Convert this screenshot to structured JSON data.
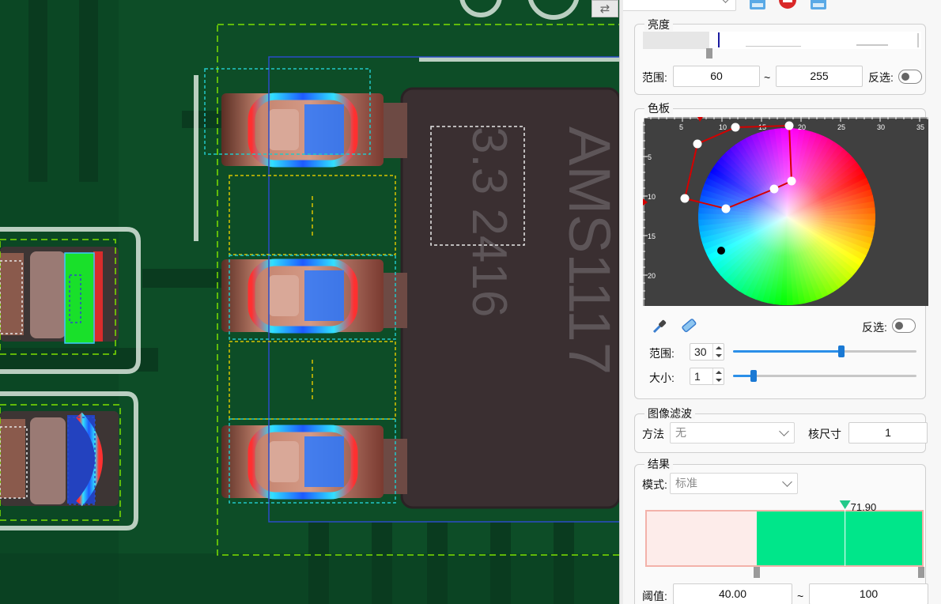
{
  "viewer": {
    "chip_top_text": "AMS1117",
    "chip_bottom_text": "3.3 2416",
    "swap_icon": "swap-arrows-icon"
  },
  "toolbar": {
    "icons": [
      "save-icon",
      "stop-icon",
      "save-as-icon"
    ]
  },
  "brightness": {
    "title": "亮度",
    "range_label": "范围:",
    "low": "60",
    "sep": "~",
    "high": "255",
    "invert_label": "反选:",
    "invert_on": false
  },
  "palette": {
    "title": "色板",
    "x_ticks": [
      "5",
      "10",
      "15",
      "20",
      "25",
      "30",
      "35"
    ],
    "y_ticks": [
      "5",
      "10",
      "15",
      "20"
    ],
    "invert_label": "反选:",
    "invert_on": false,
    "range_label": "范围:",
    "range_value": "30",
    "range_fraction": 0.59,
    "size_label": "大小:",
    "size_value": "1",
    "size_fraction": 0.11,
    "tools": [
      "eyedropper-icon",
      "eraser-icon"
    ]
  },
  "filter": {
    "title": "图像滤波",
    "method_label": "方法",
    "method_value": "无",
    "kernel_label": "核尺寸",
    "kernel_value": "1"
  },
  "result": {
    "title": "结果",
    "mode_label": "模式:",
    "mode_value": "标准",
    "marker_value": "71.90",
    "threshold_label": "阈值:",
    "threshold_low": "40.00",
    "sep": "~",
    "threshold_high": "100",
    "colors": {
      "pass": "#00e68a",
      "fail_bg": "#fdecea",
      "marker": "#22c98a"
    }
  },
  "colors": {
    "accent": "#2b8fe8",
    "polygon": "#d40000"
  }
}
